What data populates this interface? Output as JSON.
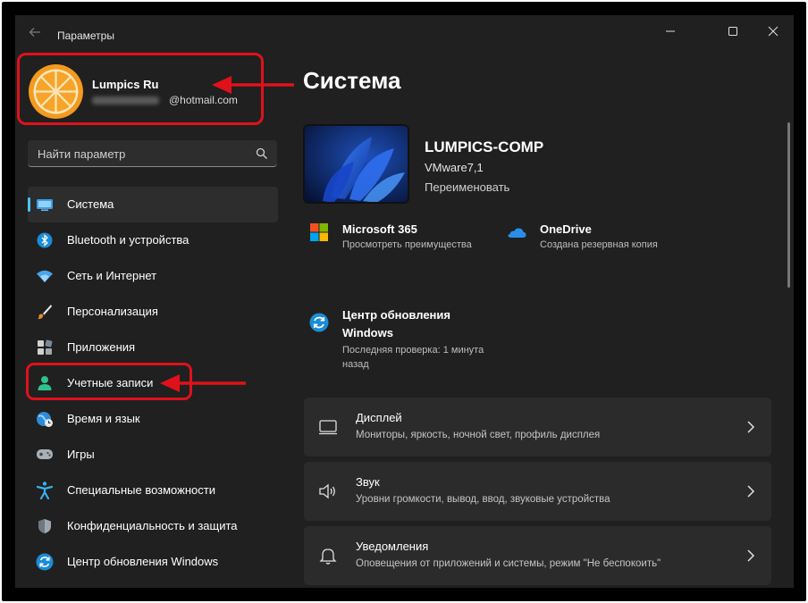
{
  "window": {
    "title": "Параметры"
  },
  "profile": {
    "name": "Lumpics Ru",
    "email_visible": "@hotmail.com"
  },
  "search": {
    "placeholder": "Найти параметр"
  },
  "sidebar": {
    "items": [
      {
        "label": "Система",
        "icon": "system-icon",
        "active": true
      },
      {
        "label": "Bluetooth и устройства",
        "icon": "bluetooth-icon"
      },
      {
        "label": "Сеть и Интернет",
        "icon": "wifi-icon"
      },
      {
        "label": "Персонализация",
        "icon": "brush-icon"
      },
      {
        "label": "Приложения",
        "icon": "apps-icon"
      },
      {
        "label": "Учетные записи",
        "icon": "account-icon"
      },
      {
        "label": "Время и язык",
        "icon": "time-language-icon"
      },
      {
        "label": "Игры",
        "icon": "gamepad-icon"
      },
      {
        "label": "Специальные возможности",
        "icon": "accessibility-icon"
      },
      {
        "label": "Конфиденциальность и защита",
        "icon": "shield-icon"
      },
      {
        "label": "Центр обновления Windows",
        "icon": "update-icon"
      }
    ]
  },
  "main": {
    "title": "Система",
    "pc": {
      "name": "LUMPICS-COMP",
      "model": "VMware7,1",
      "rename": "Переименовать"
    },
    "tiles": [
      {
        "title": "Microsoft 365",
        "subtitle": "Просмотреть преимущества",
        "icon": "microsoft-365-icon"
      },
      {
        "title": "OneDrive",
        "subtitle": "Создана резервная копия",
        "icon": "onedrive-icon"
      }
    ],
    "update": {
      "title": "Центр обновления Windows",
      "subtitle": "Последняя проверка: 1 минута назад"
    },
    "cards": [
      {
        "title": "Дисплей",
        "subtitle": "Мониторы, яркость, ночной свет, профиль дисплея",
        "icon": "display-icon"
      },
      {
        "title": "Звук",
        "subtitle": "Уровни громкости, вывод, ввод, звуковые устройства",
        "icon": "sound-icon"
      },
      {
        "title": "Уведомления",
        "subtitle": "Оповещения от приложений и системы, режим \"Не беспокоить\"",
        "icon": "bell-icon"
      }
    ]
  },
  "colors": {
    "accent": "#4cc2ff",
    "annotation_red": "#e0111b",
    "background": "#202020",
    "card": "#2b2b2b"
  }
}
